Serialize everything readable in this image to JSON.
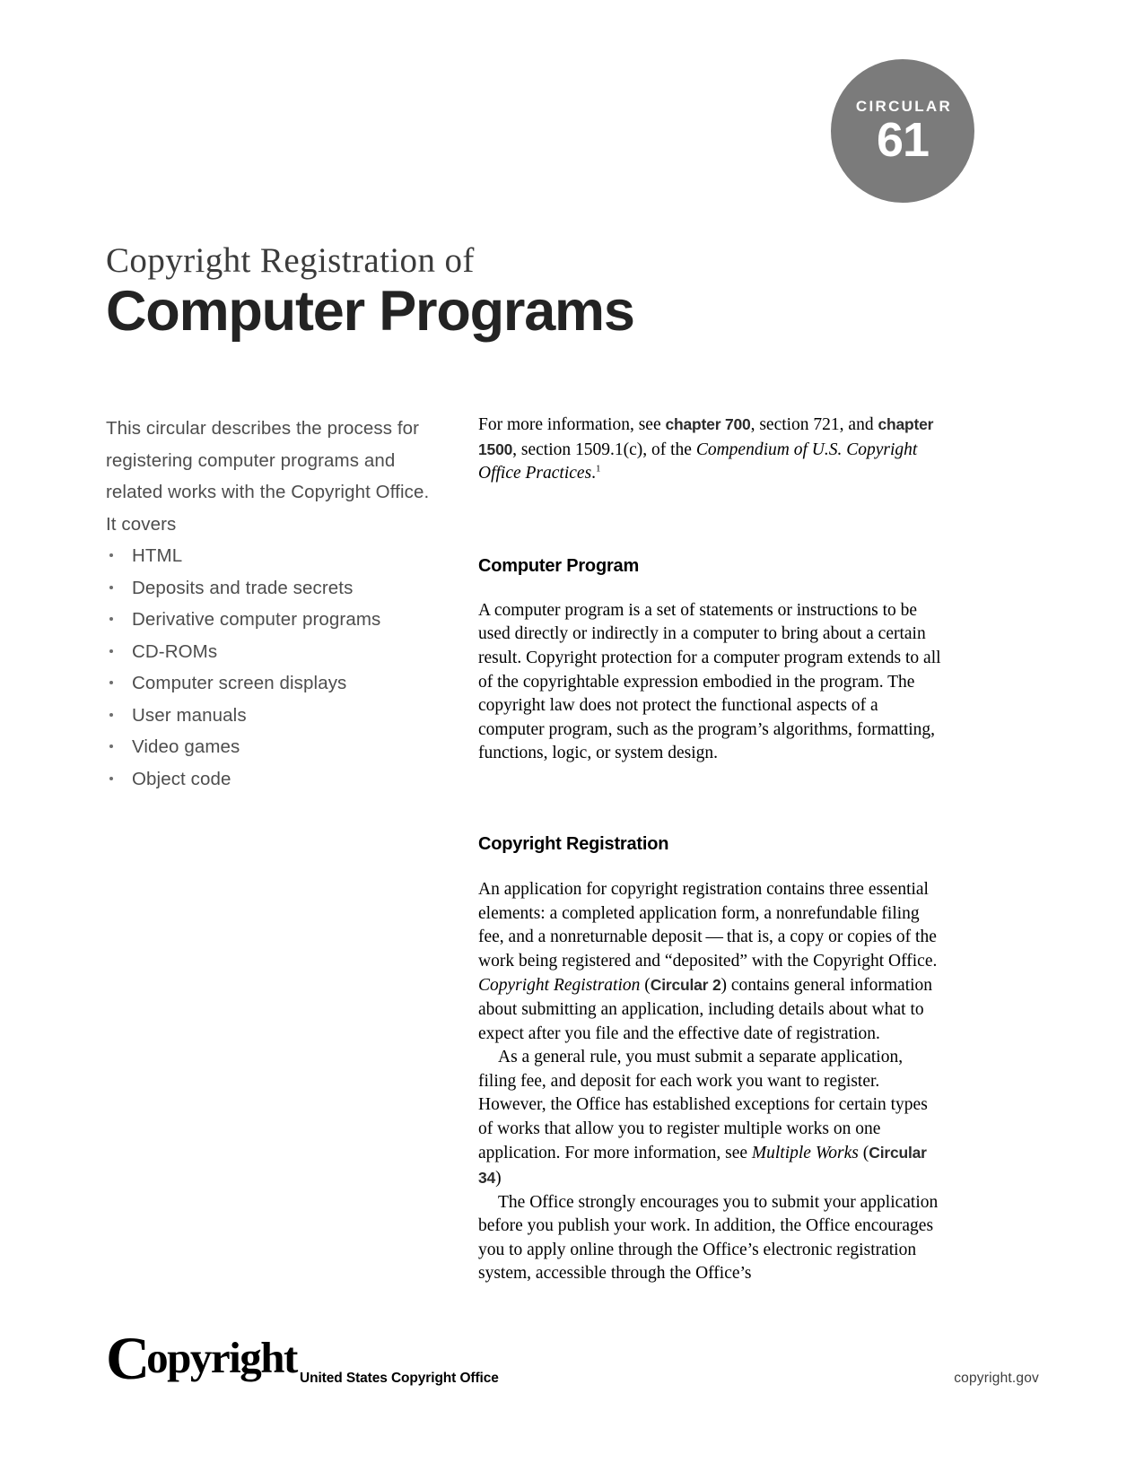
{
  "badge": {
    "label": "CIRCULAR",
    "number": "61",
    "color": "#7b7b7b"
  },
  "title": {
    "kicker": "Copyright Registration of",
    "main": "Computer Programs"
  },
  "left_column": {
    "lede": "This circular describes the process for registering computer programs and related works with the Copyright Office. It covers",
    "bullets": [
      "HTML",
      "Deposits and trade secrets",
      "Derivative computer programs",
      "CD-ROMs",
      "Computer screen displays",
      "User manuals",
      "Video games",
      "Object code"
    ]
  },
  "right_column": {
    "intro": {
      "text_1": "For more information, see ",
      "link_1": "chapter 700",
      "text_2": ", section 721, and ",
      "link_2": "chapter 1500",
      "text_3": ", section 1509.1(c), of the ",
      "italic_1": "Compendium of U.S. Copyright Office Practices",
      "text_4": ".",
      "footnote_marker": "1"
    },
    "sections": [
      {
        "heading": "Computer Program",
        "paragraphs": [
          "A computer program is a set of statements or instructions to be used directly or indirectly in a computer to bring about a certain result. Copyright protection for a computer program extends to all of the copyrightable expression embodied in the program. The copyright law does not protect the functional aspects of a computer program, such as the program’s algorithms, formatting, functions, logic, or system design."
        ]
      },
      {
        "heading": "Copyright Registration",
        "para_1": {
          "text_1": "An application for copyright registration contains three essential elements: a completed application form, a nonrefundable filing fee, and a nonreturnable deposit — that is, a copy or copies of the work being registered and “deposited” with the Copyright Office. ",
          "italic_1": "Copyright Registration",
          "text_2": " (",
          "link_1": "Circular 2",
          "text_3": ") contains general information about submitting an application, including details about what to expect after you file and the effective date of registration."
        },
        "para_2": {
          "text_1": "As a general rule, you must submit a separate application, filing fee, and deposit for each work you want to register. However, the Office has established exceptions for certain types of works that allow you to register multiple works on one application. For more information, see ",
          "italic_1": "Multiple Works",
          "text_2": " (",
          "link_1": "Circular 34",
          "text_3": ")"
        },
        "para_3": {
          "text_1": "The Office strongly encourages you to submit your application before you publish your work. In addition, the Office encourages you to apply online through the Office’s electronic registration system, accessible through the Office’s"
        }
      }
    ]
  },
  "footer": {
    "logo_initial": "C",
    "logo_rest": "opyright",
    "office": "United States Copyright Office",
    "website": "copyright.gov"
  }
}
